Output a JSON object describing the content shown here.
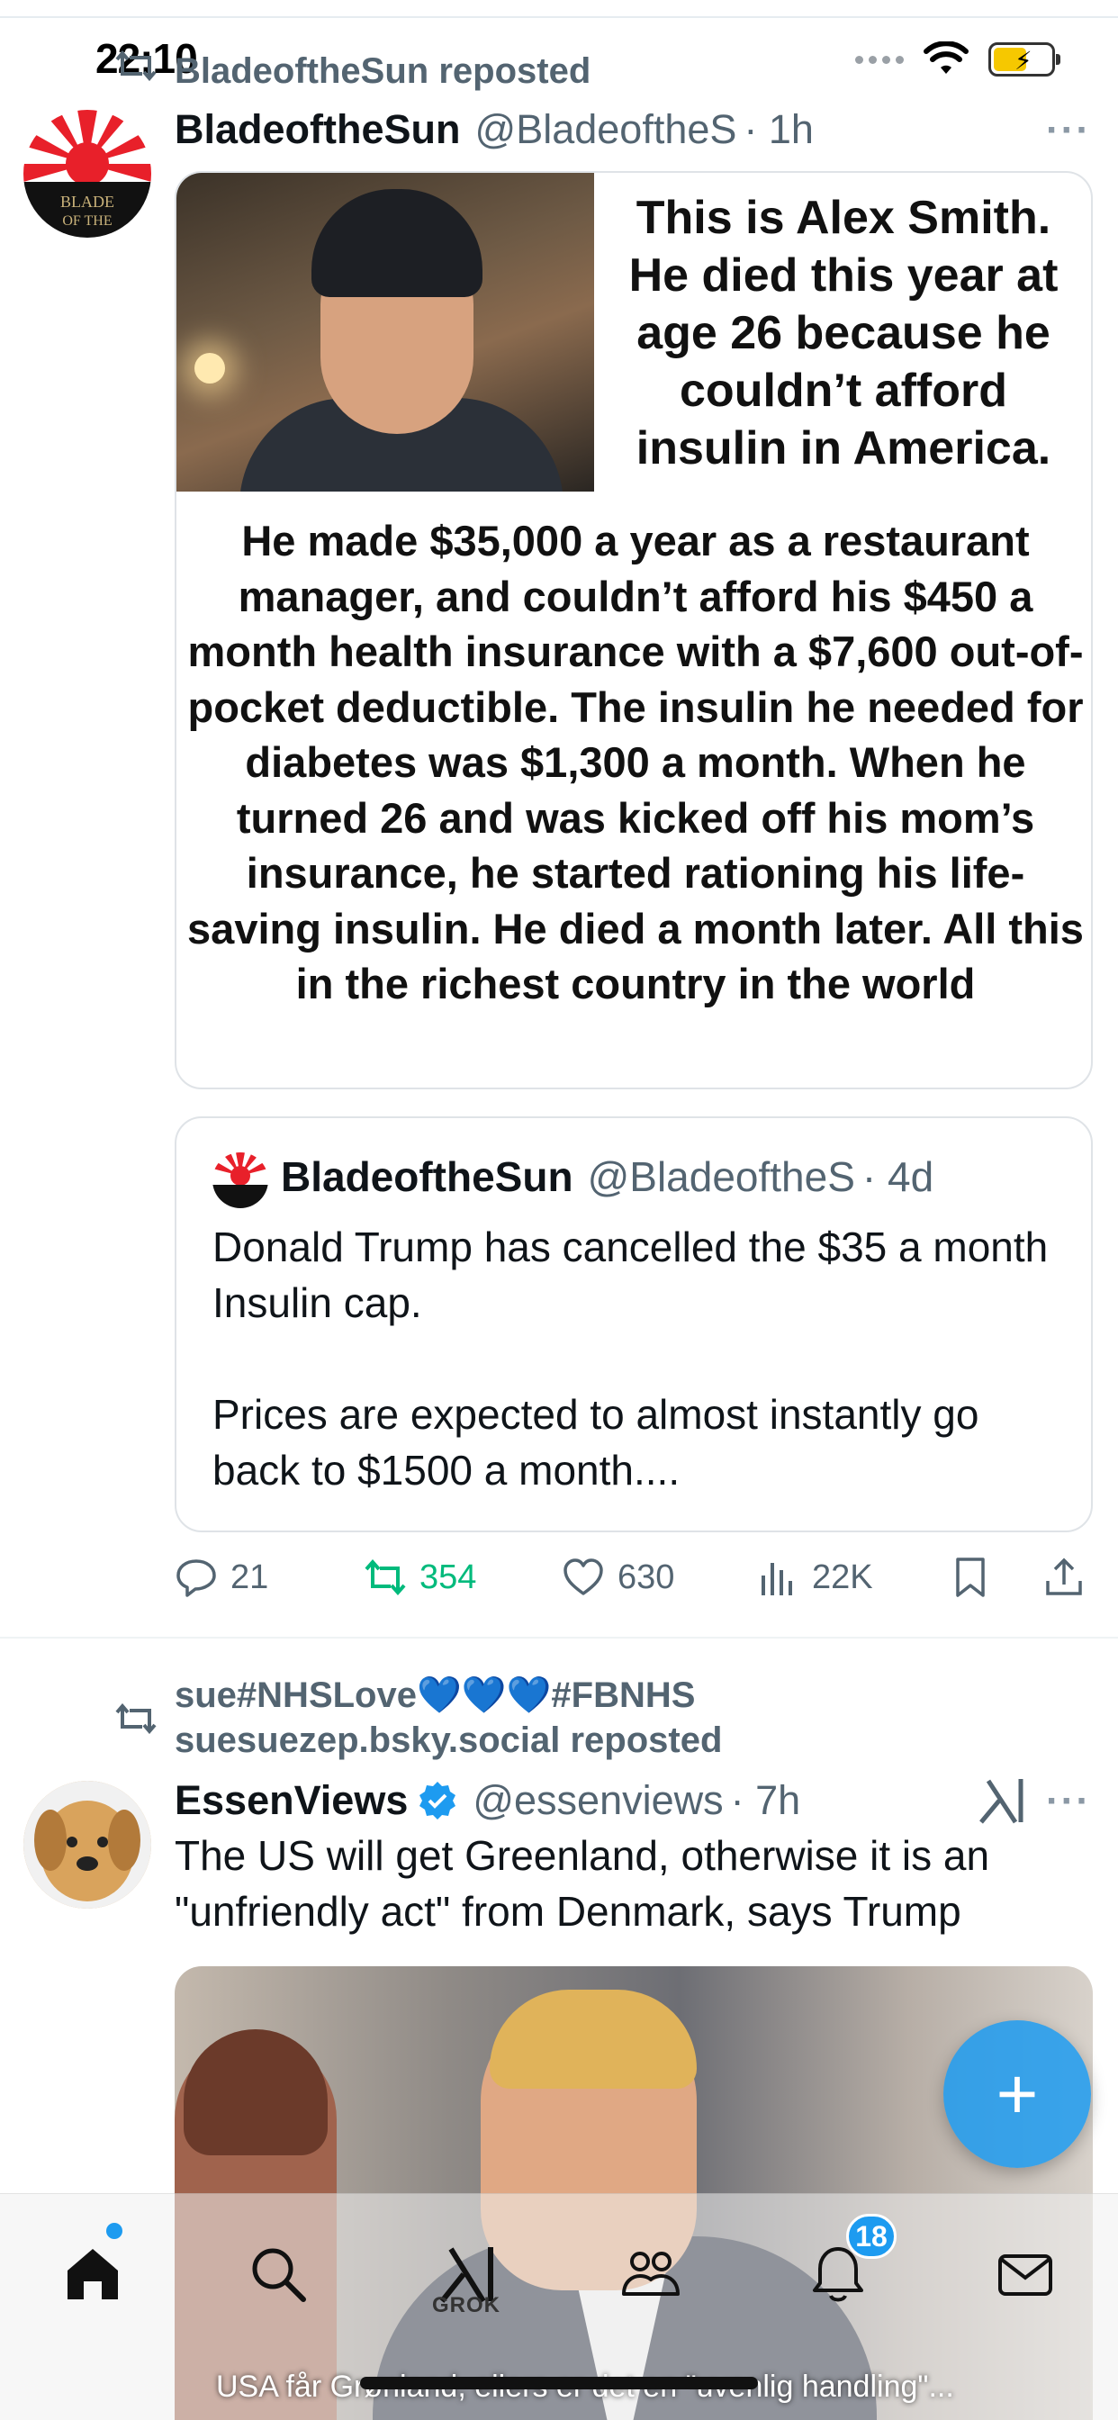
{
  "status_bar": {
    "time": "22:10",
    "battery_color": "#f6c800"
  },
  "tweet1": {
    "repost_label": "BladeoftheSun reposted",
    "name": "BladeoftheSun",
    "handle": "@BladeoftheS",
    "time": "· 1h",
    "more": "···",
    "avatar_text": "BLADE OF THE",
    "image_text_top": "This is Alex Smith. He died this year at age 26 because he couldn’t afford insulin in America.",
    "image_text_body": "He made $35,000 a year as a restaurant manager, and couldn’t afford his $450 a month health insurance with a $7,600 out-of-pocket deductible. The insulin he needed for diabetes was $1,300 a month. When he turned 26 and was kicked off his mom’s insurance, he started rationing his life-saving insulin. He died a month later. All this in the richest country in the world",
    "quote": {
      "name": "BladeoftheSun",
      "handle": "@BladeoftheS",
      "time": "· 4d",
      "paragraph1": "Donald Trump has cancelled the $35 a month Insulin cap.",
      "paragraph2": "Prices are expected to almost instantly go back to $1500 a month...."
    },
    "actions": {
      "replies": "21",
      "reposts": "354",
      "likes": "630",
      "views": "22K"
    }
  },
  "tweet2": {
    "repost_line1": "sue#NHSLove💙💙💙#FBNHS",
    "repost_line2": "suesuezep.bsky.social reposted",
    "name": "EssenViews",
    "handle": "@essenviews",
    "time": "· 7h",
    "more": "···",
    "text": "The US will get Greenland, otherwise it is an \"unfriendly act\" from Denmark, says Trump",
    "image_caption": "USA får Grønland, ellers er det en \"uvenlig handling\"..."
  },
  "fab": {
    "label": "+"
  },
  "tabbar": {
    "grok_label": "GROK",
    "notifications_badge": "18"
  },
  "colors": {
    "accent": "#1d9bf0",
    "retweet_green": "#00ba7c",
    "secondary_text": "#536471",
    "verified": "#1d9bf0"
  }
}
